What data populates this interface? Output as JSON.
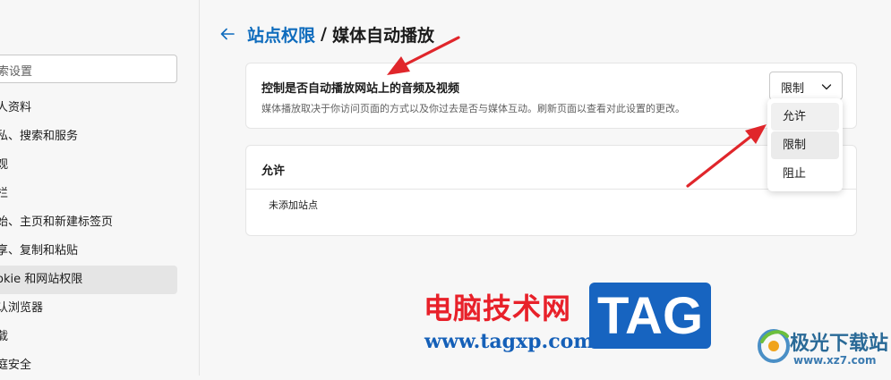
{
  "sidebar": {
    "search_placeholder": "索设置",
    "items": [
      {
        "label": "人资料"
      },
      {
        "label": "私、搜索和服务"
      },
      {
        "label": "观"
      },
      {
        "label": "栏"
      },
      {
        "label": "始、主页和新建标签页"
      },
      {
        "label": "享、复制和粘贴"
      },
      {
        "label": "okie 和网站权限",
        "active": true
      },
      {
        "label": "认浏览器"
      },
      {
        "label": "载"
      },
      {
        "label": "庭安全"
      }
    ]
  },
  "header": {
    "breadcrumb_link": "站点权限",
    "separator": "/",
    "current": "媒体自动播放"
  },
  "autoplay": {
    "title": "控制是否自动播放网站上的音频及视频",
    "description": "媒体播放取决于你访问页面的方式以及你过去是否与媒体互动。刷新页面以查看对此设置的更改。",
    "selected": "限制",
    "options": [
      "允许",
      "限制",
      "阻止"
    ]
  },
  "allow_section": {
    "title": "允许",
    "empty_text": "未添加站点"
  },
  "watermark": {
    "site_name_cn": "电脑技术网",
    "site_url": "www.tagxp.com",
    "tag_label": "TAG",
    "xz_name": "极光下载站",
    "xz_url": "www.xz7.com"
  },
  "colors": {
    "accent": "#0f6cbd",
    "annotation_arrow": "#e0262b",
    "tag_blue": "#1764c0"
  }
}
